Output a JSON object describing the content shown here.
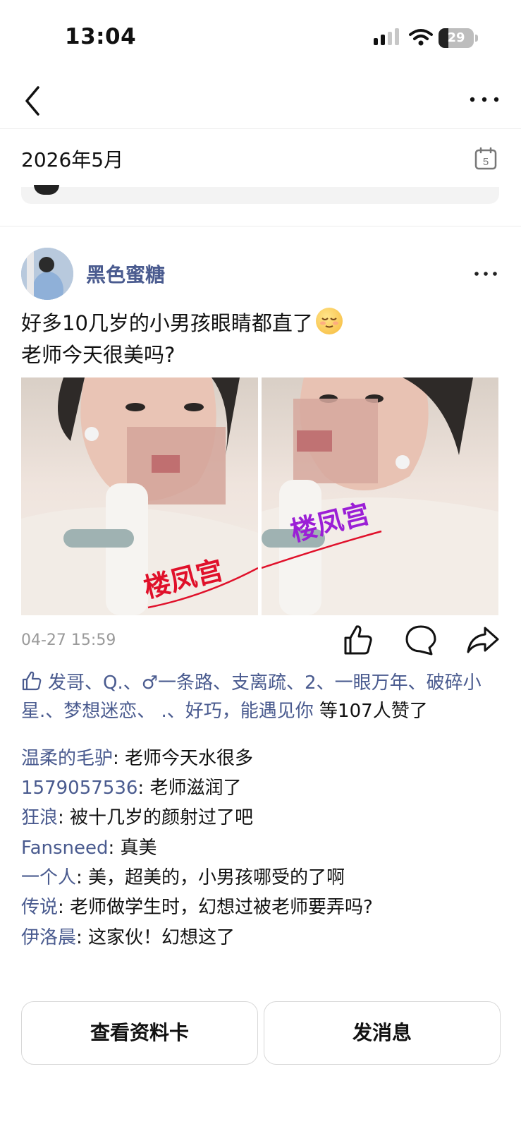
{
  "status_bar": {
    "time": "13:04",
    "battery": "29"
  },
  "header": {
    "month": "2026年5月",
    "calendar_day": "5"
  },
  "post": {
    "author": "黑色蜜糖",
    "text_line1": "好多10几岁的小男孩眼睛都直了",
    "text_line2": "老师今天很美吗?",
    "watermark": "楼凤宫",
    "timestamp": "04-27 15:59",
    "likes_names": "发哥、Q.、♂一条路、支离疏、2、一眼万年、破碎小星.、梦想迷恋、                    .、好巧，能遇见你",
    "likes_suffix": " 等107人赞了"
  },
  "comments": [
    {
      "name": "温柔的毛驴",
      "text": ": 老师今天水很多"
    },
    {
      "name": "1579057536",
      "text": ": 老师滋润了"
    },
    {
      "name": "狂浪",
      "text": ": 被十几岁的颜射过了吧"
    },
    {
      "name": "Fansneed",
      "text": ": 真美"
    },
    {
      "name": "一个人",
      "text": ": 美，超美的，小男孩哪受的了啊"
    },
    {
      "name": "传说",
      "text": ": 老师做学生时，幻想过被老师要弄吗?"
    },
    {
      "name": "伊洛晨",
      "text": ": 这家伙！幻想这了"
    }
  ],
  "buttons": {
    "profile": "查看资料卡",
    "message": "发消息"
  },
  "colors": {
    "link": "#4a5b8f",
    "watermark_red": "#e0102a",
    "watermark_purple": "#9b1fd6"
  }
}
